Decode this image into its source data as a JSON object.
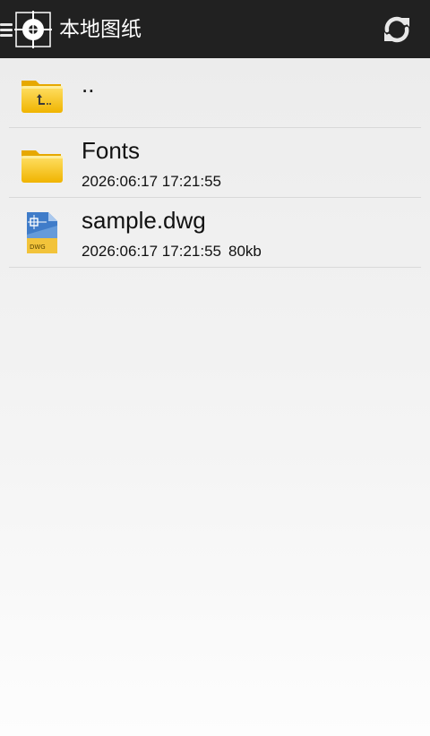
{
  "appbar": {
    "title": "本地图纸",
    "icons": {
      "menu": "menu-icon",
      "logo": "crosshair-logo-icon",
      "refresh": "refresh-icon"
    }
  },
  "files": [
    {
      "name": "..",
      "type": "parent-folder",
      "icon": "folder-up-icon"
    },
    {
      "name": "Fonts",
      "type": "folder",
      "date": "2026:06:17 17:21:55",
      "icon": "folder-icon"
    },
    {
      "name": "sample.dwg",
      "type": "dwg",
      "date": "2026:06:17 17:21:55",
      "size": "80kb",
      "icon": "dwg-file-icon",
      "badge": "DWG"
    }
  ],
  "colors": {
    "appbar": "#212121",
    "folder": "#f5c518",
    "dwg_blue": "#3f7cc9",
    "dwg_yellow": "#f2c33a"
  }
}
